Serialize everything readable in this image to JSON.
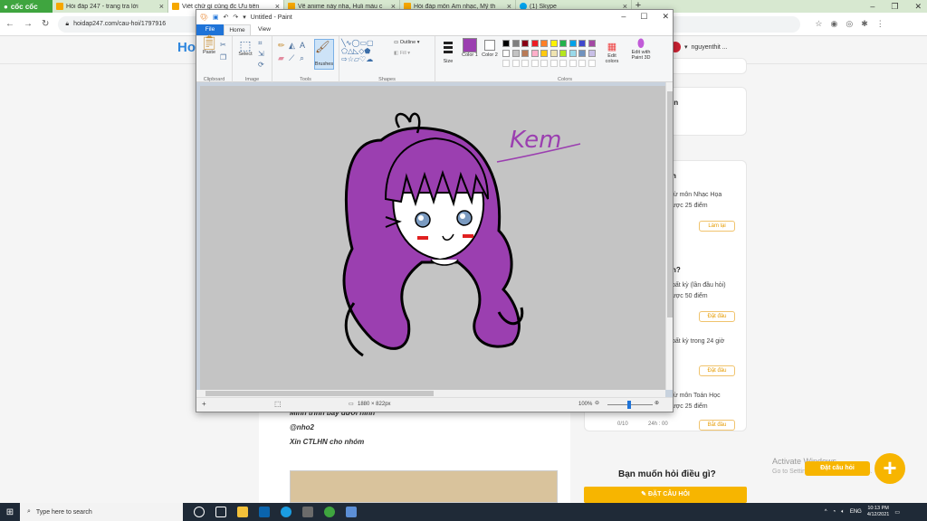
{
  "browser": {
    "brand": "cốc cốc",
    "tabs": [
      {
        "title": "Hỏi đáp 247 - trang tra lời",
        "active": false
      },
      {
        "title": "Viết chữ gì cũng đc Ưu tiên",
        "active": true
      },
      {
        "title": "Vẽ anime này nha, Huli màu c",
        "active": false
      },
      {
        "title": "Hỏi đáp môn Âm nhạc, Mỹ th",
        "active": false
      },
      {
        "title": "(1) Skype",
        "active": false
      }
    ],
    "new_tab": "+",
    "url": "hoidap247.com/cau-hoi/1797916",
    "user": "nguyenthit ..."
  },
  "paint": {
    "title": "Untitled - Paint",
    "menu": {
      "file": "File",
      "home": "Home",
      "view": "View"
    },
    "groups": {
      "clipboard": "Clipboard",
      "image": "Image",
      "tools": "Tools",
      "shapes": "Shapes",
      "colors": "Colors"
    },
    "tools": {
      "paste": "Paste",
      "select": "Select",
      "brushes": "Brushes",
      "outline": "Outline",
      "fill": "Fill",
      "size": "Size",
      "color1": "Color 1",
      "color2": "Color 2",
      "edit_colors": "Edit colors",
      "edit_paint3d": "Edit with Paint 3D"
    },
    "color1": "#9b3fb0",
    "color2": "#ffffff",
    "palette": [
      "#000000",
      "#7f7f7f",
      "#880015",
      "#ed1c24",
      "#ff7f27",
      "#fff200",
      "#22b14c",
      "#00a2e8",
      "#3f48cc",
      "#a349a4",
      "#ffffff",
      "#c3c3c3",
      "#b97a57",
      "#ffaec9",
      "#ffc90e",
      "#efe4b0",
      "#b5e61d",
      "#99d9ea",
      "#7092be",
      "#c8bfe7"
    ],
    "status": {
      "size": "1880 × 822px",
      "zoom": "100%"
    },
    "drawing_text": "Kem"
  },
  "page": {
    "logo": "Ho",
    "side": {
      "title_in": "in",
      "h": "h",
      "music_task": "từ môn Nhạc Họa",
      "music_points": "ược 25 điểm",
      "do_now": "Làm lại",
      "question": "n?",
      "any_task": "bất kỳ (lần đầu hỏi)",
      "any_points": "ược 50 điểm",
      "ask_now": "Đặt đâu",
      "any2": "bất kỳ  trong 24 giờ",
      "ask_now2": "Đặt đâu",
      "math_task": "từ môn Toán Học",
      "math_points": "ược 25 điểm",
      "meta1": "0/10",
      "meta2": "24h : 00",
      "do_now2": "Bắt đầu"
    },
    "answer": {
      "line1": "Mình trình bày dưới hình",
      "line2": "@nho2",
      "line3": "Xin CTLHN cho nhóm"
    },
    "ask_question": "Bạn muốn hỏi điều gì?",
    "ask_button": "ĐẶT CÂU HỎI",
    "float_label": "Đặt câu hỏi",
    "float_plus": "+",
    "activate": "Activate Windows",
    "activate_sub": "Go to Settings to activate Windows."
  },
  "taskbar": {
    "search_placeholder": "Type here to search",
    "lang": "ENG",
    "time": "10:13 PM",
    "date": "4/12/2021"
  }
}
